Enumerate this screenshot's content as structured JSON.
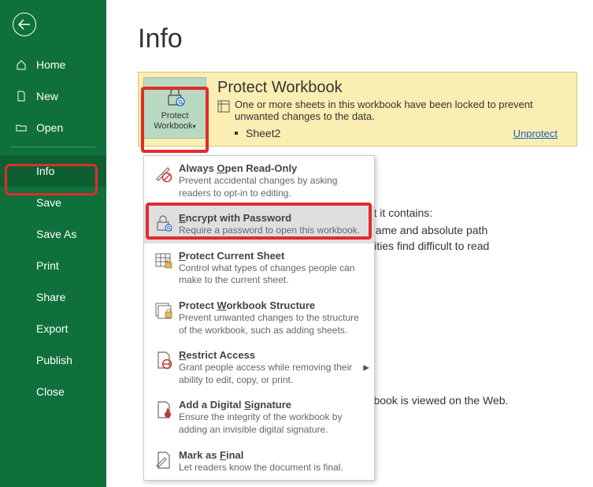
{
  "sidebar": {
    "items": [
      {
        "label": "Home"
      },
      {
        "label": "New"
      },
      {
        "label": "Open"
      },
      {
        "label": "Info"
      },
      {
        "label": "Save"
      },
      {
        "label": "Save As"
      },
      {
        "label": "Print"
      },
      {
        "label": "Share"
      },
      {
        "label": "Export"
      },
      {
        "label": "Publish"
      },
      {
        "label": "Close"
      }
    ]
  },
  "page": {
    "title": "Info"
  },
  "protect": {
    "button_line1": "Protect",
    "button_line2": "Workbook",
    "heading": "Protect Workbook",
    "message": "One or more sheets in this workbook have been locked to prevent unwanted changes to the data.",
    "sheet": "Sheet2",
    "unprotect": "Unprotect"
  },
  "info_block": {
    "line1": "that it contains:",
    "line2": "name and absolute path",
    "line3": "ilities find difficult to read"
  },
  "browser_block": {
    "line": "orkbook is viewed on the Web."
  },
  "menu": {
    "items": [
      {
        "title_pre": "Always ",
        "title_u": "O",
        "title_post": "pen Read-Only",
        "desc": "Prevent accidental changes by asking readers to opt-in to editing."
      },
      {
        "title_pre": "",
        "title_u": "E",
        "title_post": "ncrypt with Password",
        "desc": "Require a password to open this workbook."
      },
      {
        "title_pre": "",
        "title_u": "P",
        "title_post": "rotect Current Sheet",
        "desc": "Control what types of changes people can make to the current sheet."
      },
      {
        "title_pre": "Protect ",
        "title_u": "W",
        "title_post": "orkbook Structure",
        "desc": "Prevent unwanted changes to the structure of the workbook, such as adding sheets."
      },
      {
        "title_pre": "",
        "title_u": "R",
        "title_post": "estrict Access",
        "desc": "Grant people access while removing their ability to edit, copy, or print."
      },
      {
        "title_pre": "Add a Digital ",
        "title_u": "S",
        "title_post": "ignature",
        "desc": "Ensure the integrity of the workbook by adding an invisible digital signature."
      },
      {
        "title_pre": "Mark as ",
        "title_u": "F",
        "title_post": "inal",
        "desc": "Let readers know the document is final."
      }
    ]
  }
}
